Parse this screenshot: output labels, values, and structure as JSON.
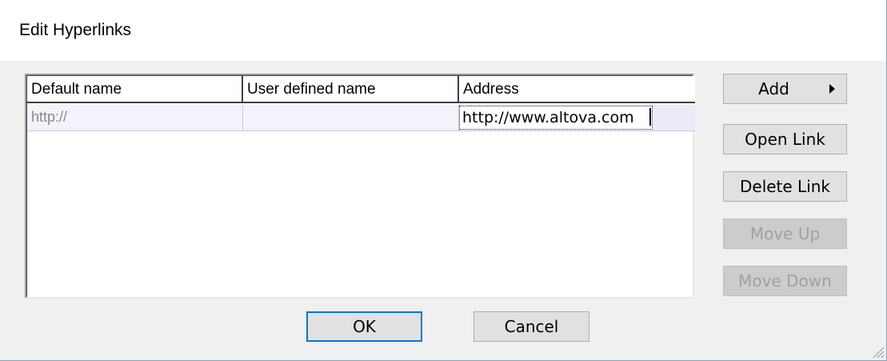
{
  "dialog": {
    "title": "Edit Hyperlinks"
  },
  "grid": {
    "columns": [
      "Default name",
      "User defined name",
      "Address"
    ],
    "rows": [
      {
        "default_name": "http://",
        "user_defined_name": "",
        "address": "http://www.altova.com"
      }
    ]
  },
  "side_buttons": {
    "add": "Add",
    "open_link": "Open Link",
    "delete_link": "Delete Link",
    "move_up": "Move Up",
    "move_down": "Move Down"
  },
  "footer": {
    "ok": "OK",
    "cancel": "Cancel"
  },
  "icons": {
    "add_submenu": "right-arrow-icon",
    "size_grip": "resize-grip-icon"
  },
  "colors": {
    "focus_border": "#0078d7",
    "disabled_text": "#a0a0a0"
  }
}
